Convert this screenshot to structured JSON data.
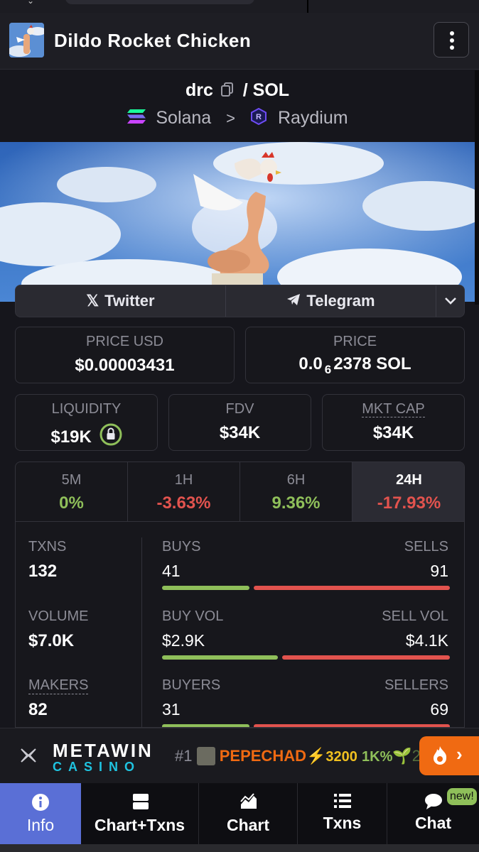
{
  "header": {
    "title": "Dildo Rocket Chicken"
  },
  "pair": {
    "base": "drc",
    "slash": "/",
    "quote": "SOL"
  },
  "chain": {
    "network": "Solana",
    "arrow": ">",
    "dex": "Raydium"
  },
  "socials": {
    "twitter": "Twitter",
    "telegram": "Telegram"
  },
  "price_usd": {
    "label": "PRICE USD",
    "value": "$0.00003431"
  },
  "price_sol": {
    "label": "PRICE",
    "prefix": "0.0",
    "zeros": "6",
    "rest": "2378 SOL"
  },
  "liquidity": {
    "label": "LIQUIDITY",
    "value": "$19K"
  },
  "fdv": {
    "label": "FDV",
    "value": "$34K"
  },
  "mkt_cap": {
    "label": "MKT CAP",
    "value": "$34K"
  },
  "timeframes": [
    {
      "label": "5M",
      "value": "0%",
      "color": "#8fbf5a"
    },
    {
      "label": "1H",
      "value": "-3.63%",
      "color": "#e2534e"
    },
    {
      "label": "6H",
      "value": "9.36%",
      "color": "#8fbf5a"
    },
    {
      "label": "24H",
      "value": "-17.93%",
      "color": "#e2534e"
    }
  ],
  "stats": {
    "txns": {
      "label": "TXNS",
      "value": "132"
    },
    "volume": {
      "label": "VOLUME",
      "value": "$7.0K"
    },
    "makers": {
      "label": "MAKERS",
      "value": "82"
    },
    "buys": {
      "label": "BUYS",
      "value": "41"
    },
    "sells": {
      "label": "SELLS",
      "value": "91"
    },
    "buy_vol": {
      "label": "BUY VOL",
      "value": "$2.9K"
    },
    "sell_vol": {
      "label": "SELL VOL",
      "value": "$4.1K"
    },
    "buyers": {
      "label": "BUYERS",
      "value": "31"
    },
    "sellers": {
      "label": "SELLERS",
      "value": "69"
    },
    "buy_share": [
      0.31,
      0.41,
      0.31
    ]
  },
  "ad": {
    "brand_top": "METAWIN",
    "brand_bottom": "CASINO",
    "rank": "#1",
    "token": "PEPECHAD",
    "amount": "3200",
    "pct": "1K%",
    "tail": "2"
  },
  "nav": {
    "info": "Info",
    "chart_txns": "Chart+Txns",
    "chart": "Chart",
    "txns": "Txns",
    "chat": "Chat",
    "new_badge": "new!"
  },
  "colors": {
    "green": "#8fbf5a",
    "red": "#e2534e",
    "accent_tab": "#5a6fd6",
    "orange": "#f06a12"
  }
}
